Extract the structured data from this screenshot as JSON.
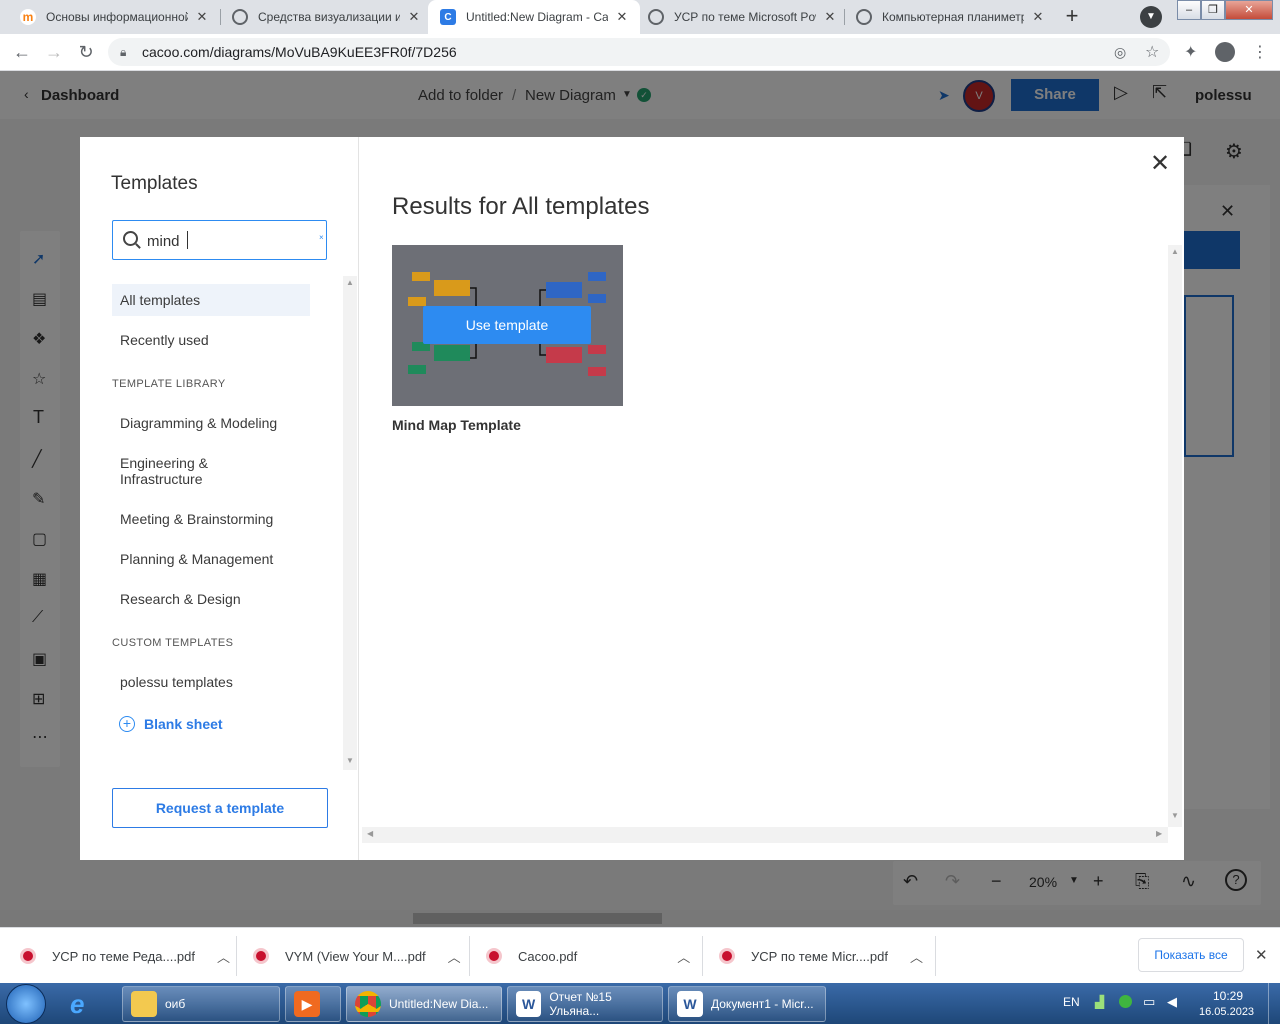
{
  "browser": {
    "tabs": [
      {
        "title": "Основы информационной",
        "icon": "moodle-icon",
        "color": "#f98012"
      },
      {
        "title": "Средства визуализации ин",
        "icon": "globe-icon",
        "color": "#5f6368"
      },
      {
        "title": "Untitled:New Diagram - Ca",
        "icon": "cacoo-icon",
        "color": "#2d7be5"
      },
      {
        "title": "УСР по теме Microsoft Pow",
        "icon": "globe-icon",
        "color": "#5f6368"
      },
      {
        "title": "Компьютерная планиметр",
        "icon": "globe-icon",
        "color": "#5f6368"
      }
    ],
    "url": "cacoo.com/diagrams/MoVuBA9KuEE3FR0f/7D256"
  },
  "app": {
    "back_label": "Dashboard",
    "add_to_folder": "Add to folder",
    "breadcrumb_sep": "/",
    "diagram_name": "New Diagram",
    "avatar_letter": "V",
    "share_label": "Share",
    "username": "polessu",
    "zoom": "20%"
  },
  "modal": {
    "title": "Templates",
    "search_value": "mind",
    "nav_top": [
      "All templates",
      "Recently used"
    ],
    "library_heading": "TEMPLATE LIBRARY",
    "library_items": [
      "Diagramming & Modeling",
      "Engineering &\nInfrastructure",
      "Meeting & Brainstorming",
      "Planning & Management",
      "Research & Design"
    ],
    "custom_heading": "CUSTOM TEMPLATES",
    "custom_items": [
      "polessu templates"
    ],
    "blank_sheet": "Blank sheet",
    "request_label": "Request a template",
    "results_heading": "Results for All templates",
    "template_card": {
      "title": "Mind Map Template",
      "use_label": "Use template"
    }
  },
  "downloads": {
    "items": [
      "УСР по теме Реда....pdf",
      "VYM (View Your M....pdf",
      "Cacoo.pdf",
      "УСР по теме Micr....pdf"
    ],
    "show_all": "Показать все"
  },
  "taskbar": {
    "items": [
      {
        "label": "оиб",
        "icon": "folder-icon"
      },
      {
        "label": "",
        "icon": "media-player-icon"
      },
      {
        "label": "Untitled:New Dia...",
        "icon": "chrome-icon"
      },
      {
        "label": "Отчет №15 Ульяна...",
        "icon": "word-icon"
      },
      {
        "label": "Документ1 - Micr...",
        "icon": "word-icon"
      }
    ],
    "lang": "EN",
    "time": "10:29",
    "date": "16.05.2023"
  },
  "colors": {
    "accent": "#2d8bf1",
    "share": "#1f6fd1",
    "ok_green": "#25a36f"
  }
}
